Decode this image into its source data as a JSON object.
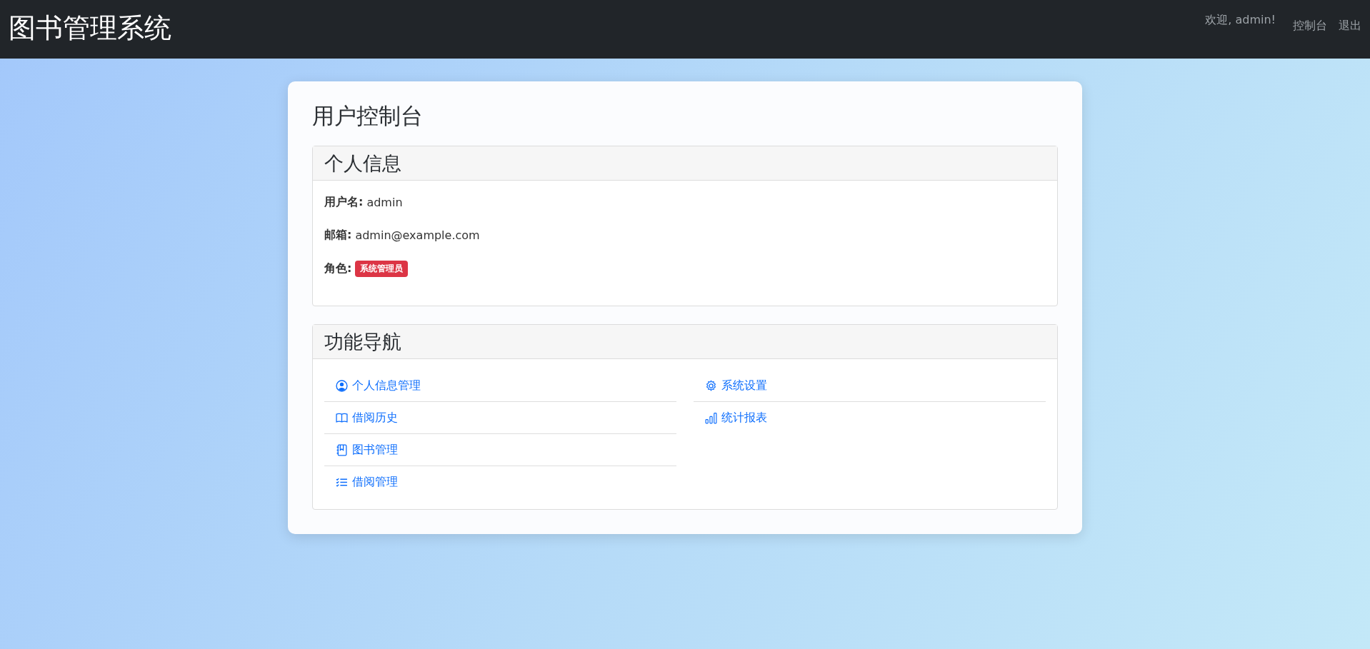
{
  "navbar": {
    "brand": "图书管理系统",
    "welcome": "欢迎, admin!",
    "links": [
      "控制台",
      "退出"
    ]
  },
  "dashboard": {
    "title": "用户控制台",
    "profile": {
      "title": "个人信息",
      "fields": [
        {
          "label": "用户名:",
          "value": "admin",
          "kind": "text"
        },
        {
          "label": "邮箱:",
          "value": "admin@example.com",
          "kind": "text"
        },
        {
          "label": "角色:",
          "value": "系统管理员",
          "kind": "badge"
        }
      ]
    },
    "navigation": {
      "title": "功能导航",
      "columns": [
        [
          "个人信息管理",
          "借阅历史",
          "图书管理",
          "借阅管理"
        ],
        [
          "系统设置",
          "统计报表"
        ]
      ]
    }
  }
}
